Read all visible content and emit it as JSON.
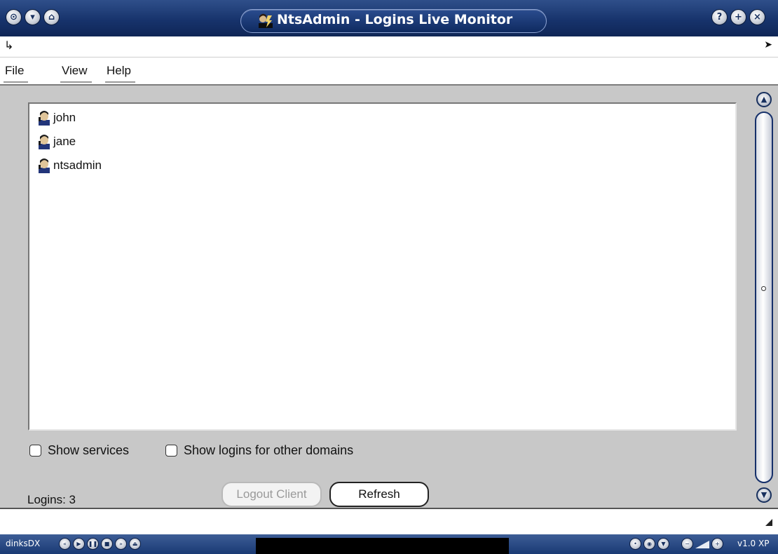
{
  "window": {
    "title": "NtsAdmin - Logins Live Monitor",
    "app_icon": "admin-user-icon",
    "left_controls": [
      "menu-icon",
      "minimize-icon",
      "shade-icon"
    ],
    "right_controls": [
      "help-icon",
      "maximize-icon",
      "close-icon"
    ],
    "control_glyphs": {
      "menu": "⊙",
      "minimize": "▾",
      "shade": "⌂",
      "help": "?",
      "maximize": "+",
      "close": "×"
    }
  },
  "strip": {
    "left_icon": "arrow-icon",
    "right_icon": "cursor-icon",
    "left_glyph": "↳",
    "right_glyph": "➤"
  },
  "menu": {
    "file": "File",
    "view": "View",
    "help": "Help"
  },
  "logins": {
    "items": [
      {
        "label": "john",
        "icon": "user-icon"
      },
      {
        "label": "jane",
        "icon": "user-icon"
      },
      {
        "label": "ntsadmin",
        "icon": "user-icon"
      }
    ]
  },
  "options": {
    "show_services": "Show services",
    "show_services_checked": false,
    "show_other_domains": "Show logins for other domains",
    "show_other_domains_checked": false
  },
  "footer": {
    "logins_count": "Logins: 3",
    "logout_label": "Logout Client",
    "logout_enabled": false,
    "refresh_label": "Refresh"
  },
  "scrollbar": {
    "up_glyph": "▲",
    "down_glyph": "▼"
  },
  "taskbar": {
    "left_label": "dinksDX",
    "right_label": "v1.0 XP",
    "left_glyphs": [
      "«",
      "▶",
      "❚❚",
      "■",
      "»",
      "⏏"
    ],
    "right_glyphs": [
      "•",
      "◉",
      "▼",
      "−",
      "+"
    ]
  },
  "colors": {
    "titlebar": "#17336c",
    "content_bg": "#c8c8c8",
    "disabled_text": "#9a9a9a"
  }
}
